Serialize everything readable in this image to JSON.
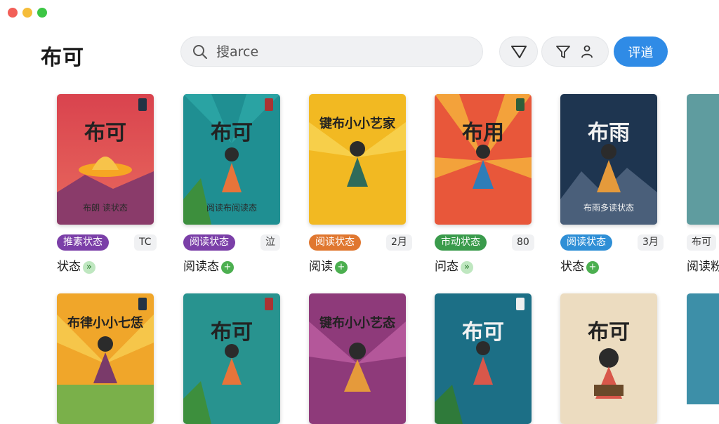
{
  "app": {
    "title": "布可"
  },
  "search": {
    "placeholder": "搜arce"
  },
  "toolbar": {
    "primary_label": "评道"
  },
  "icons": {
    "search": "search-icon",
    "filter": "filter-icon",
    "funnel": "funnel-icon",
    "person": "person-icon",
    "plus": "plus-icon"
  },
  "books_row1": [
    {
      "cover_title": "布可",
      "cover_subtitle": "布朗 读状态",
      "status": "推素状态",
      "status_color": "#7b3fa8",
      "count": "TC",
      "label": "状态"
    },
    {
      "cover_title": "布可",
      "cover_subtitle": "阅读布阅读态",
      "status": "阅读状态",
      "status_color": "#7b3fa8",
      "count": "泣",
      "label": "阅读态"
    },
    {
      "cover_title": "键布小小艺家",
      "cover_subtitle": "",
      "status": "阅读状态",
      "status_color": "#e0772f",
      "count": "2月",
      "label": "阅读"
    },
    {
      "cover_title": "布用",
      "cover_subtitle": "",
      "status": "市动状态",
      "status_color": "#3a9b4c",
      "count": "80",
      "label": "问态"
    },
    {
      "cover_title": "布雨",
      "cover_subtitle": "布雨多读状态",
      "status": "阅读状态",
      "status_color": "#2f8fd6",
      "count": "3月",
      "label": "状态"
    },
    {
      "cover_title": "",
      "cover_subtitle": "",
      "status": "",
      "status_color": "#ffffff",
      "count": "布可",
      "label": "阅读粉"
    }
  ],
  "books_row2": [
    {
      "cover_title": "布律小小七恁"
    },
    {
      "cover_title": "布可"
    },
    {
      "cover_title": "键布小小艺态"
    },
    {
      "cover_title": "布可"
    },
    {
      "cover_title": "布可"
    }
  ]
}
